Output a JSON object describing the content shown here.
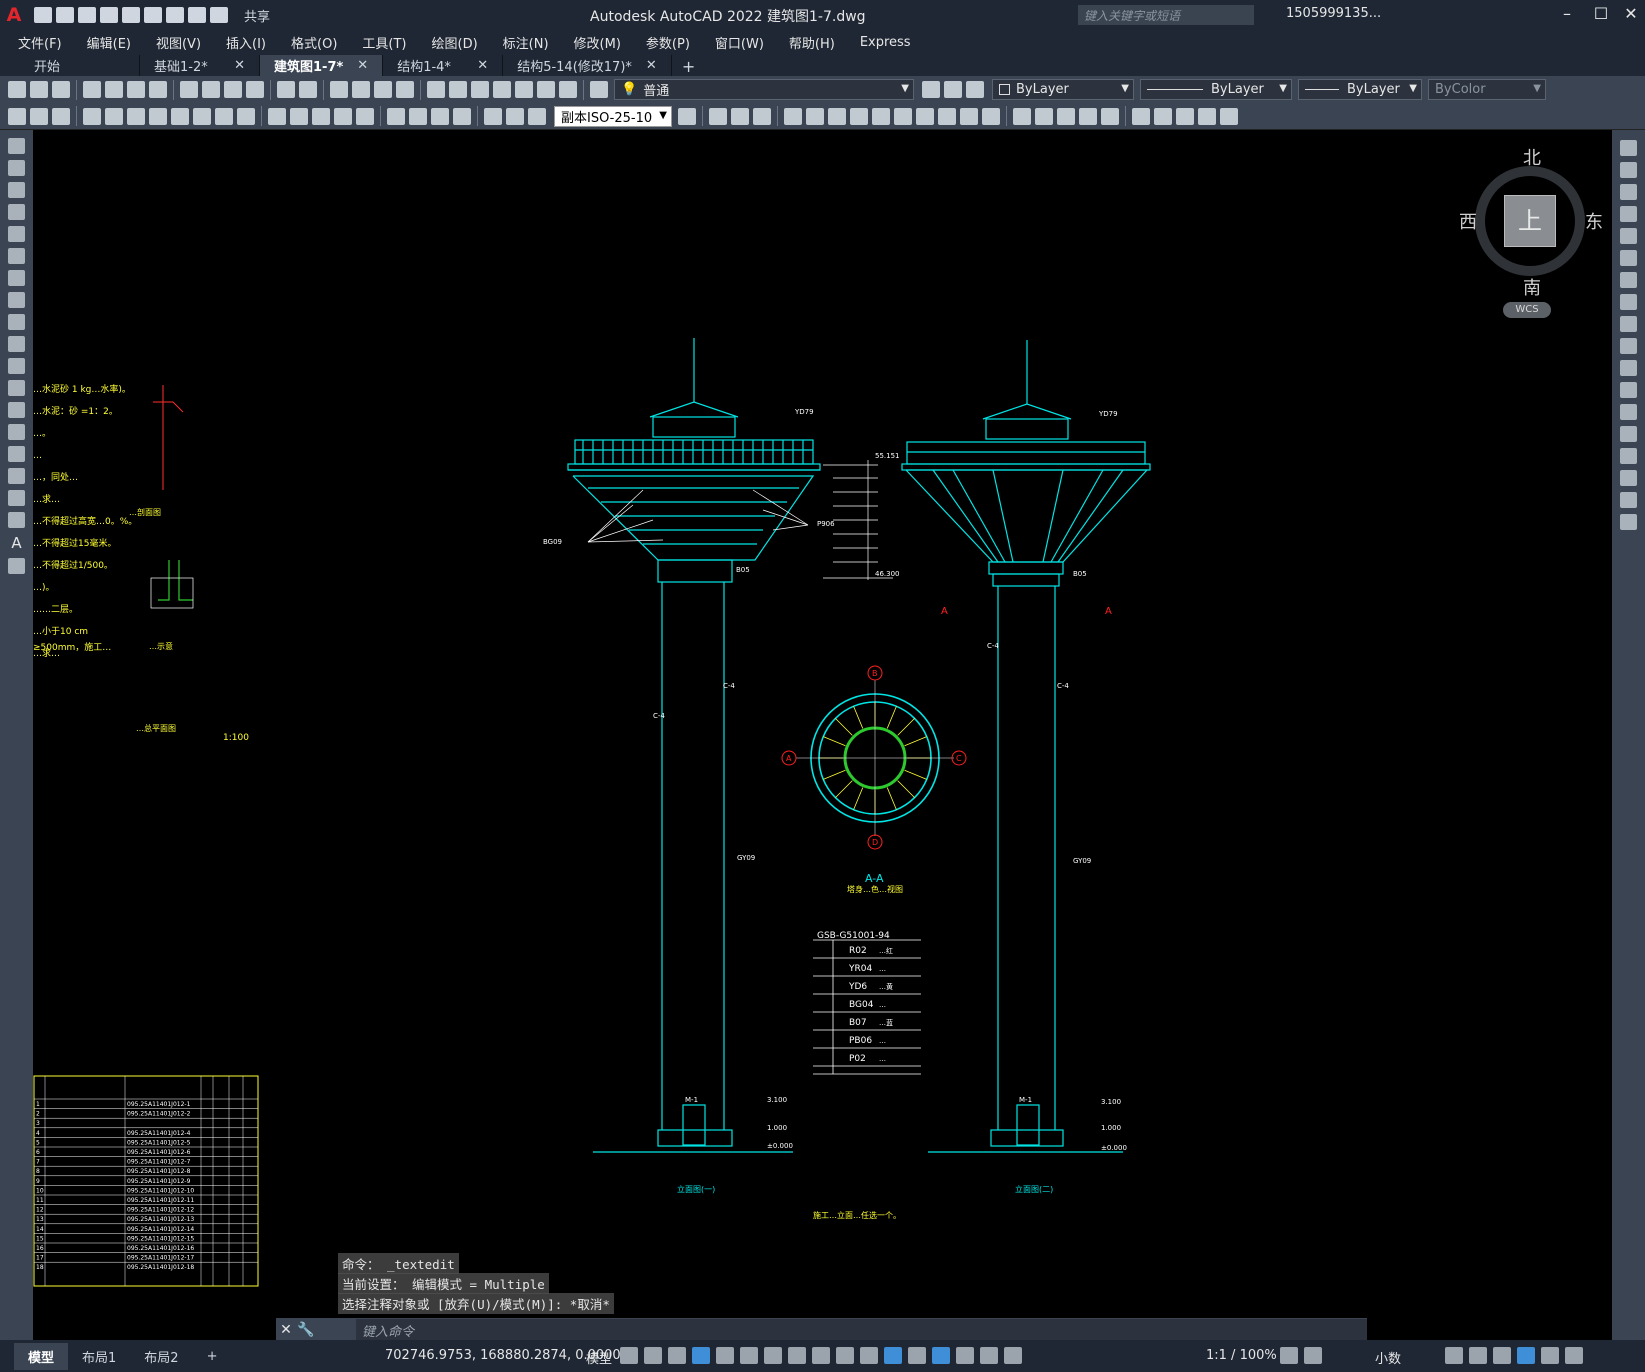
{
  "app": {
    "logo": "A",
    "title": "Autodesk AutoCAD 2022    建筑图1-7.dwg",
    "share": "共享",
    "search_placeholder": "键入关键字或短语",
    "user": "1505999135...",
    "help": "?"
  },
  "menu": [
    "文件(F)",
    "编辑(E)",
    "视图(V)",
    "插入(I)",
    "格式(O)",
    "工具(T)",
    "绘图(D)",
    "标注(N)",
    "修改(M)",
    "参数(P)",
    "窗口(W)",
    "帮助(H)",
    "Express"
  ],
  "tabs": [
    {
      "label": "开始",
      "active": false,
      "closable": false
    },
    {
      "label": "基础1-2*",
      "active": false,
      "closable": true
    },
    {
      "label": "建筑图1-7*",
      "active": true,
      "closable": true
    },
    {
      "label": "结构1-4*",
      "active": false,
      "closable": true
    },
    {
      "label": "结构5-14(修改17)*",
      "active": false,
      "closable": true
    }
  ],
  "toolbar": {
    "layer": "普通",
    "color": "ByLayer",
    "linetype": "ByLayer",
    "lineweight": "ByLayer",
    "plotstyle": "ByColor",
    "dimstyle": "副本ISO-25-10"
  },
  "viewcube": {
    "north": "北",
    "south": "南",
    "west": "西",
    "east": "东",
    "face": "上",
    "wcs": "WCS"
  },
  "drawing": {
    "left_notes": [
      "…水泥砂 1 kg…水率)。",
      "…水泥：砂 =1：2。",
      "…。",
      "…",
      "…，同处…",
      "…求…",
      "…不得超过高宽…0。%。",
      "…不得超过15毫米。",
      "…不得超过1/500。",
      "…)。",
      "……二层。",
      "…小于10 cm",
      "…求…"
    ],
    "note_500": "≥500mm，施工…",
    "detail1_title": "…剖面图",
    "detail2_title": "…示意",
    "map_title": "…总平面图",
    "map_scale": "1:100",
    "section_title": "A-A",
    "section_subtitle": "塔身…色…视图",
    "elev1_title": "立面图(一)",
    "elev2_title": "立面图(二)",
    "footer_note": "施工…立面…任选一个。",
    "section_mark": "A",
    "axis_marks": [
      "B",
      "A",
      "C",
      "D"
    ],
    "col_label": "C-4",
    "tag_b05": "B05",
    "tag_gy09": "GY09",
    "tag_yd79": "YD79",
    "tag_p906": "P906",
    "tag_bg09": "BG09",
    "tag_m1": "M-1",
    "level_top": "55.151",
    "level_base": "46.300",
    "level_3100": "3.100",
    "level_1000": "1.000",
    "level_0": "±0.000",
    "legend_title": "GSB-G51001-94",
    "legend": [
      {
        "code": "R02",
        "name": "…红"
      },
      {
        "code": "YR04",
        "name": "…"
      },
      {
        "code": "YD6",
        "name": "…黄"
      },
      {
        "code": "BG04",
        "name": "…"
      },
      {
        "code": "B07",
        "name": "…蓝"
      },
      {
        "code": "PB06",
        "name": "…"
      },
      {
        "code": "P02",
        "name": "…"
      }
    ],
    "table_rows": [
      {
        "no": "1",
        "code": "095.25A11401J012-1"
      },
      {
        "no": "2",
        "code": "095.25A11401J012-2"
      },
      {
        "no": "3",
        "code": ""
      },
      {
        "no": "4",
        "code": "095.25A11401J012-4"
      },
      {
        "no": "5",
        "code": "095.25A11401J012-5"
      },
      {
        "no": "6",
        "code": "095.25A11401J012-6"
      },
      {
        "no": "7",
        "code": "095.25A11401J012-7"
      },
      {
        "no": "8",
        "code": "095.25A11401J012-8"
      },
      {
        "no": "9",
        "code": "095.25A11401J012-9"
      },
      {
        "no": "10",
        "code": "095.25A11401J012-10"
      },
      {
        "no": "11",
        "code": "095.25A11401J012-11"
      },
      {
        "no": "12",
        "code": "095.25A11401J012-12"
      },
      {
        "no": "13",
        "code": "095.25A11401J012-13"
      },
      {
        "no": "14",
        "code": "095.25A11401J012-14"
      },
      {
        "no": "15",
        "code": "095.25A11401J012-15"
      },
      {
        "no": "16",
        "code": "095.25A11401J012-16"
      },
      {
        "no": "17",
        "code": "095.25A11401J012-17"
      },
      {
        "no": "18",
        "code": "095.25A11401J012-18"
      }
    ]
  },
  "command": {
    "history": [
      "命令： _textedit",
      "当前设置： 编辑模式 = Multiple",
      "选择注释对象或 [放弃(U)/模式(M)]: *取消*"
    ],
    "placeholder": "键入命令"
  },
  "layouts": [
    "模型",
    "布局1",
    "布局2"
  ],
  "status": {
    "coords": "702746.9753, 168880.2874, 0.0000",
    "model": "模型",
    "scale": "1:1 / 100%",
    "units": "小数"
  }
}
